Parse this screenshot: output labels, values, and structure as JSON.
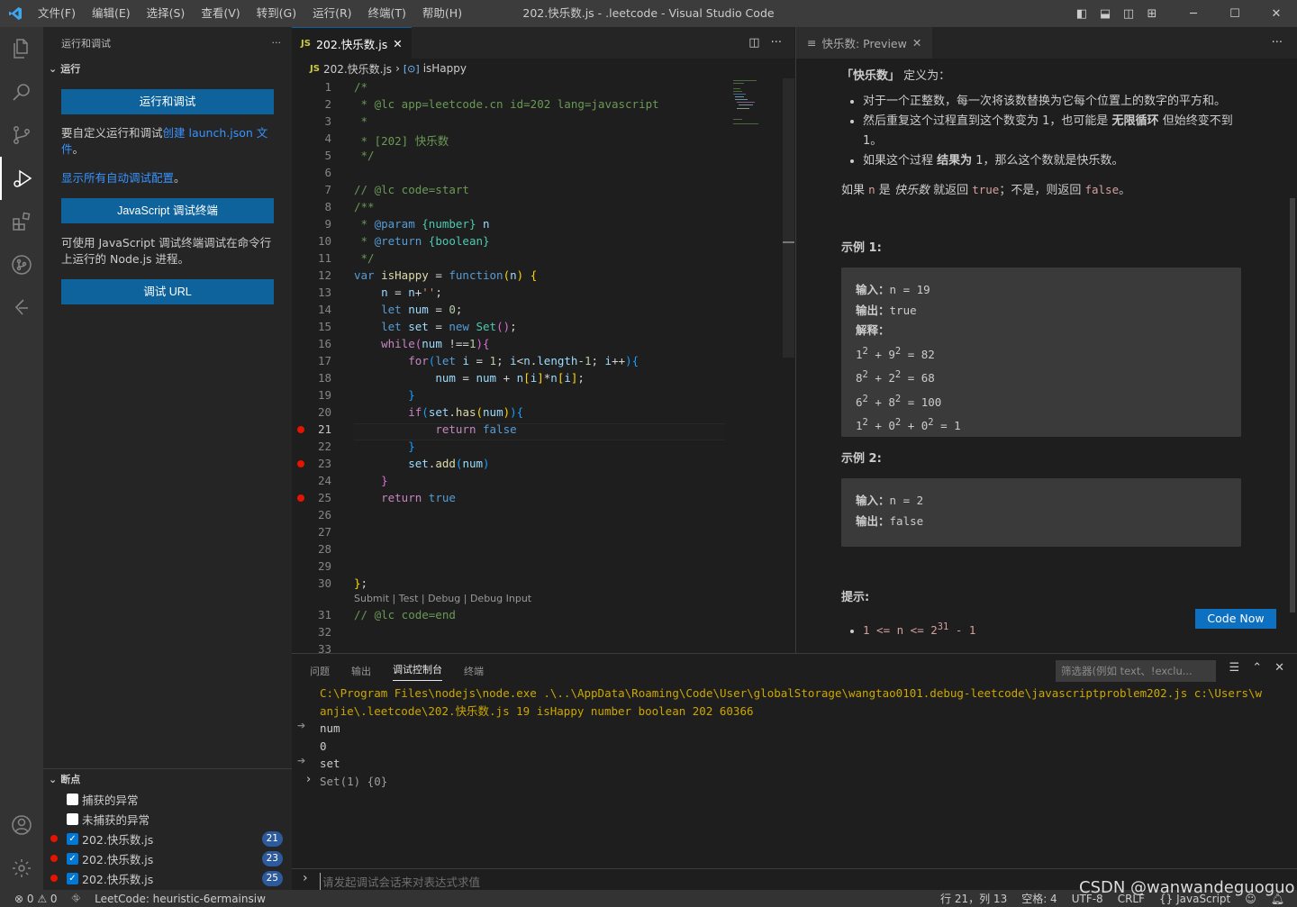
{
  "window": {
    "title": "202.快乐数.js - .leetcode - Visual Studio Code",
    "menus": [
      "文件(F)",
      "编辑(E)",
      "选择(S)",
      "查看(V)",
      "转到(G)",
      "运行(R)",
      "终端(T)",
      "帮助(H)"
    ]
  },
  "sidebar": {
    "header": "运行和调试",
    "section_run": "运行",
    "run_button": "运行和调试",
    "custom_text": "要自定义运行和调试",
    "custom_link": "创建 launch.json 文件",
    "custom_end": "。",
    "show_all_link": "显示所有自动调试配置",
    "show_all_end": "。",
    "terminal_button": "JavaScript 调试终端",
    "terminal_desc": "可使用 JavaScript 调试终端调试在命令行上运行的 Node.js 进程。",
    "url_button": "调试 URL",
    "section_breakpoints": "断点",
    "breakpoints": [
      {
        "label": "捕获的异常",
        "checked": false
      },
      {
        "label": "未捕获的异常",
        "checked": false
      },
      {
        "label": "202.快乐数.js",
        "checked": true,
        "line": "21"
      },
      {
        "label": "202.快乐数.js",
        "checked": true,
        "line": "23"
      },
      {
        "label": "202.快乐数.js",
        "checked": true,
        "line": "25"
      }
    ]
  },
  "editor": {
    "tab": "202.快乐数.js",
    "js_badge": "JS",
    "breadcrumb_file": "202.快乐数.js",
    "breadcrumb_symbol": "isHappy",
    "codelens": "Submit | Test | Debug | Debug Input"
  },
  "preview": {
    "tab": "快乐数: Preview",
    "intro_head": "「快乐数」",
    "intro_tail": "定义为：",
    "bullets": [
      "对于一个正整数，每一次将该数替换为它每个位置上的数字的平方和。",
      "然后重复这个过程直到这个数变为 1，也可能是 无限循环 但始终变不到 1。",
      "如果这个过程 结果为 1，那么这个数就是快乐数。"
    ],
    "bullet2_pre": "然后重复这个过程直到这个数变为 1，也可能是 ",
    "bullet2_bold": "无限循环",
    "bullet2_post": " 但始终变不到 1。",
    "bullet3_pre": "如果这个过程 ",
    "bullet3_bold": "结果为",
    "bullet3_post": " 1，那么这个数就是快乐数。",
    "ret_1": "如果 ",
    "ret_n": "n",
    "ret_2": " 是 ",
    "ret_happy": "快乐数",
    "ret_3": " 就返回 ",
    "ret_true": "true",
    "ret_4": "；不是，则返回 ",
    "ret_false": "false",
    "ret_5": "。",
    "example1_title": "示例 1:",
    "example2_title": "示例 2:",
    "input_label": "输入：",
    "output_label": "输出：",
    "explain_label": "解释：",
    "ex1_input": "n = 19",
    "ex1_output": "true",
    "ex2_input": "n = 2",
    "ex2_output": "false",
    "hint_title": "提示:",
    "code_now": "Code Now"
  },
  "panel": {
    "tabs": [
      "问题",
      "输出",
      "调试控制台",
      "终端"
    ],
    "filter_placeholder": "筛选器(例如 text、!exclu...",
    "console_lines": [
      "C:\\Program Files\\nodejs\\node.exe .\\..\\AppData\\Roaming\\Code\\User\\globalStorage\\wangtao0101.debug-leetcode\\javascriptproblem202.js c:\\Users\\w",
      "anjie\\.leetcode\\202.快乐数.js 19 isHappy number boolean 202 60366",
      "num",
      "0",
      "set",
      "Set(1) {0}"
    ],
    "repl_placeholder": "请发起调试会话来对表达式求值"
  },
  "statusbar": {
    "errors": "0",
    "warnings": "0",
    "leetcode": "LeetCode: heuristic-6ermainsiw",
    "position": "行 21，列 13",
    "spaces": "空格: 4",
    "encoding": "UTF-8",
    "eol": "CRLF",
    "language": "JavaScript"
  },
  "watermark": "CSDN @wanwandeguoguo"
}
